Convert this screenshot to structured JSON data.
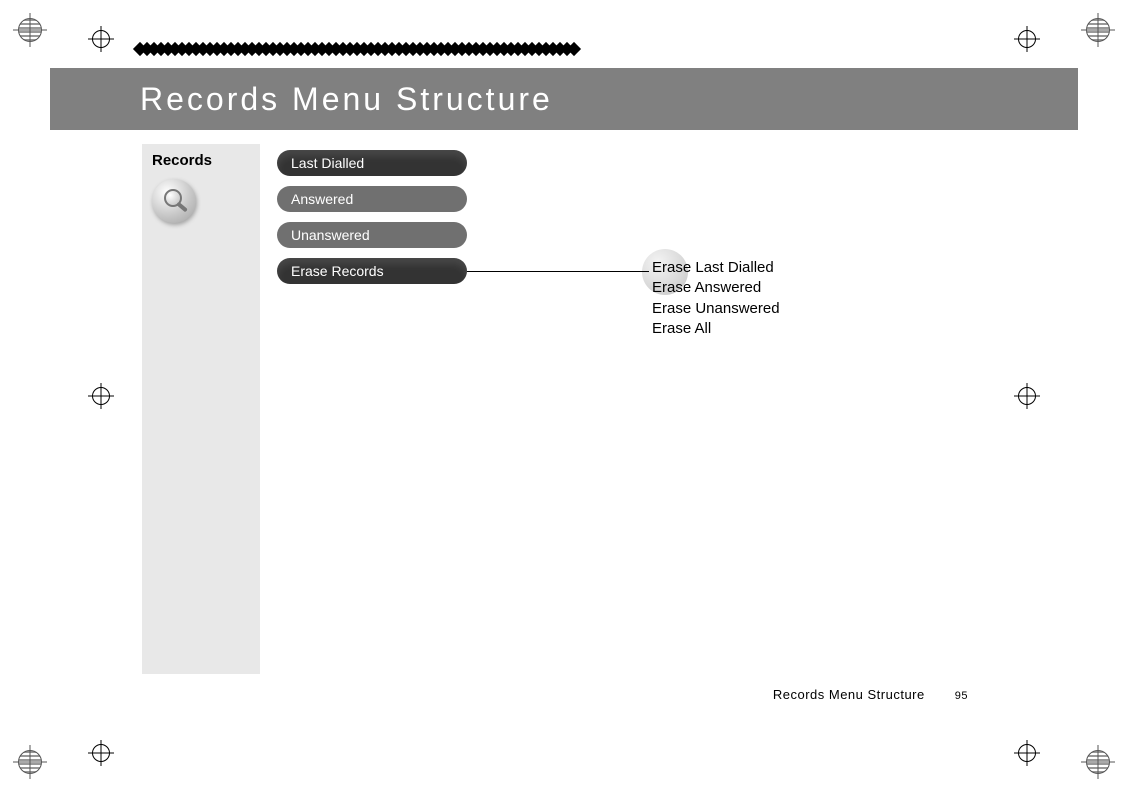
{
  "header": {
    "title": "Records Menu Structure"
  },
  "sidebar": {
    "title": "Records"
  },
  "menu": {
    "items": [
      {
        "label": "Last Dialled",
        "style": "dark"
      },
      {
        "label": "Answered",
        "style": "mid"
      },
      {
        "label": "Unanswered",
        "style": "mid"
      },
      {
        "label": "Erase Records",
        "style": "dark"
      }
    ]
  },
  "submenu": {
    "items": [
      "Erase Last Dialled",
      "Erase Answered",
      "Erase Unanswered",
      "Erase All"
    ]
  },
  "footer": {
    "section": "Records Menu Structure",
    "page": "95"
  }
}
